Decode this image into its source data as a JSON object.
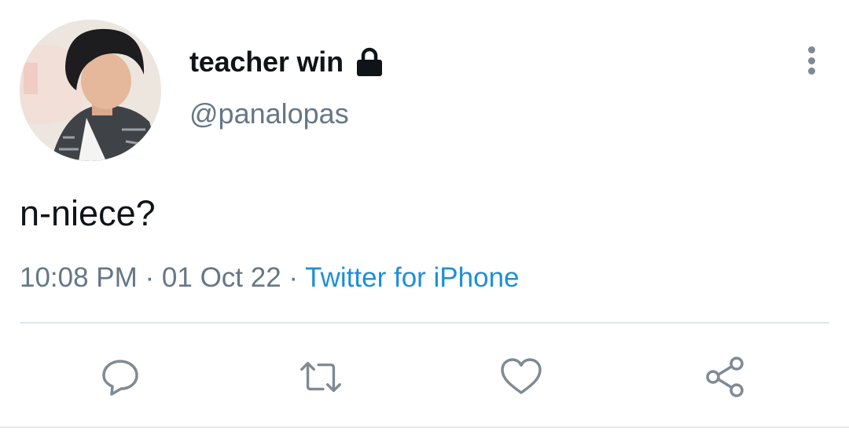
{
  "tweet": {
    "author": {
      "display_name": "teacher win",
      "handle": "@panalopas",
      "protected_icon": "lock-icon"
    },
    "text": "n-niece?",
    "meta": {
      "time": "10:08 PM",
      "separator": " · ",
      "date": "01 Oct 22",
      "source": "Twitter for iPhone"
    },
    "actions": [
      {
        "name": "reply",
        "icon": "comment-icon"
      },
      {
        "name": "retweet",
        "icon": "retweet-icon"
      },
      {
        "name": "like",
        "icon": "heart-icon"
      },
      {
        "name": "share",
        "icon": "share-icon"
      }
    ],
    "colors": {
      "text": "#0f1419",
      "secondary": "#657786",
      "link": "#1d8fd8",
      "icon": "#7f8a94"
    }
  }
}
